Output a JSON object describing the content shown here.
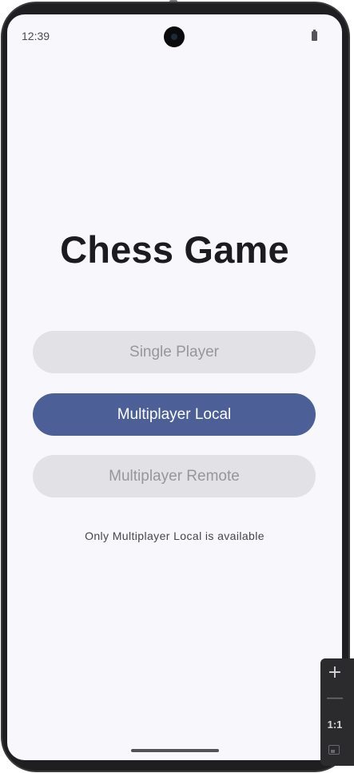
{
  "status_bar": {
    "time": "12:39",
    "icons": [
      "camera-icon",
      "battery-icon"
    ]
  },
  "app": {
    "title": "Chess Game"
  },
  "menu": {
    "buttons": [
      {
        "label": "Single Player",
        "enabled": false
      },
      {
        "label": "Multiplayer Local",
        "enabled": true
      },
      {
        "label": "Multiplayer Remote",
        "enabled": false
      }
    ],
    "info": "Only Multiplayer Local is available"
  },
  "zoom_controls": {
    "zoom_in": "+",
    "zoom_out": "—",
    "reset": "1:1",
    "fit_icon": "fit-screen-icon"
  },
  "colors": {
    "primary_button": "#4c5f96",
    "disabled_button": "#e2e1e6",
    "background": "#f8f7fc",
    "title_text": "#1c1b20"
  }
}
